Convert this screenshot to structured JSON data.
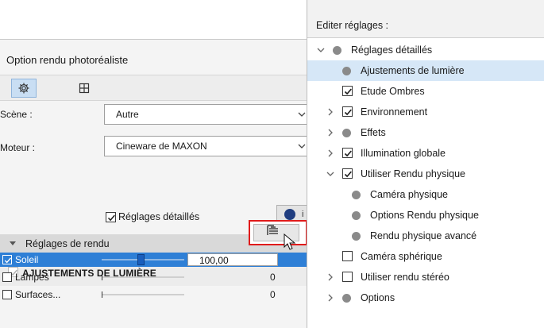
{
  "panel": {
    "title": "Option rendu photoréaliste",
    "tabs": [
      {
        "icon": "gear-icon",
        "active": true
      },
      {
        "icon": "crop-frame-icon",
        "active": false
      }
    ],
    "scene": {
      "label": "Scène :",
      "value": "Autre"
    },
    "engine": {
      "label": "Moteur :",
      "value": "Cineware de MAXON"
    },
    "detailed_settings": {
      "label": "Réglages détaillés",
      "checked": true
    },
    "info_button": {
      "icon": "maxon-sphere-icon",
      "label": "i"
    },
    "section": {
      "label": "Réglages de rendu",
      "expanded": true
    },
    "adjustments": {
      "title": "AJUSTEMENTS DE LUMIÈRE",
      "edit_icon": "edit-list-icon"
    },
    "lights": [
      {
        "name": "Soleil",
        "checked": true,
        "selected": true,
        "value": "100,00",
        "level": 0.45
      },
      {
        "name": "Lampes",
        "checked": false,
        "selected": false,
        "value": "0",
        "level": 0
      },
      {
        "name": "Surfaces...",
        "checked": false,
        "selected": false,
        "value": "0",
        "level": 0
      }
    ]
  },
  "popup": {
    "title": "Editer réglages :",
    "items": [
      {
        "label": "Réglages détaillés",
        "level": 0,
        "arrow": "down",
        "marker": "dot",
        "selected": false
      },
      {
        "label": "Ajustements de lumière",
        "level": 1,
        "arrow": "",
        "marker": "dot",
        "selected": true
      },
      {
        "label": "Etude Ombres",
        "level": 1,
        "arrow": "",
        "marker": "checked",
        "selected": false
      },
      {
        "label": "Environnement",
        "level": 1,
        "arrow": "right",
        "marker": "checked",
        "selected": false
      },
      {
        "label": "Effets",
        "level": 1,
        "arrow": "right",
        "marker": "dot",
        "selected": false
      },
      {
        "label": "Illumination globale",
        "level": 1,
        "arrow": "right",
        "marker": "checked",
        "selected": false
      },
      {
        "label": "Utiliser Rendu physique",
        "level": 1,
        "arrow": "down",
        "marker": "checked",
        "selected": false
      },
      {
        "label": "Caméra physique",
        "level": 2,
        "arrow": "",
        "marker": "dot",
        "selected": false
      },
      {
        "label": "Options Rendu physique",
        "level": 2,
        "arrow": "",
        "marker": "dot",
        "selected": false
      },
      {
        "label": "Rendu physique avancé",
        "level": 2,
        "arrow": "",
        "marker": "dot",
        "selected": false
      },
      {
        "label": "Caméra sphérique",
        "level": 1,
        "arrow": "",
        "marker": "unchecked",
        "selected": false
      },
      {
        "label": "Utiliser rendu stéréo",
        "level": 1,
        "arrow": "right",
        "marker": "unchecked",
        "selected": false
      },
      {
        "label": "Options",
        "level": 1,
        "arrow": "right",
        "marker": "dot",
        "selected": false
      }
    ]
  },
  "colors": {
    "selection_blue": "#2e7fd6",
    "highlight_row": "#d6e7f7",
    "edit_button_outline": "#e01b1b"
  }
}
